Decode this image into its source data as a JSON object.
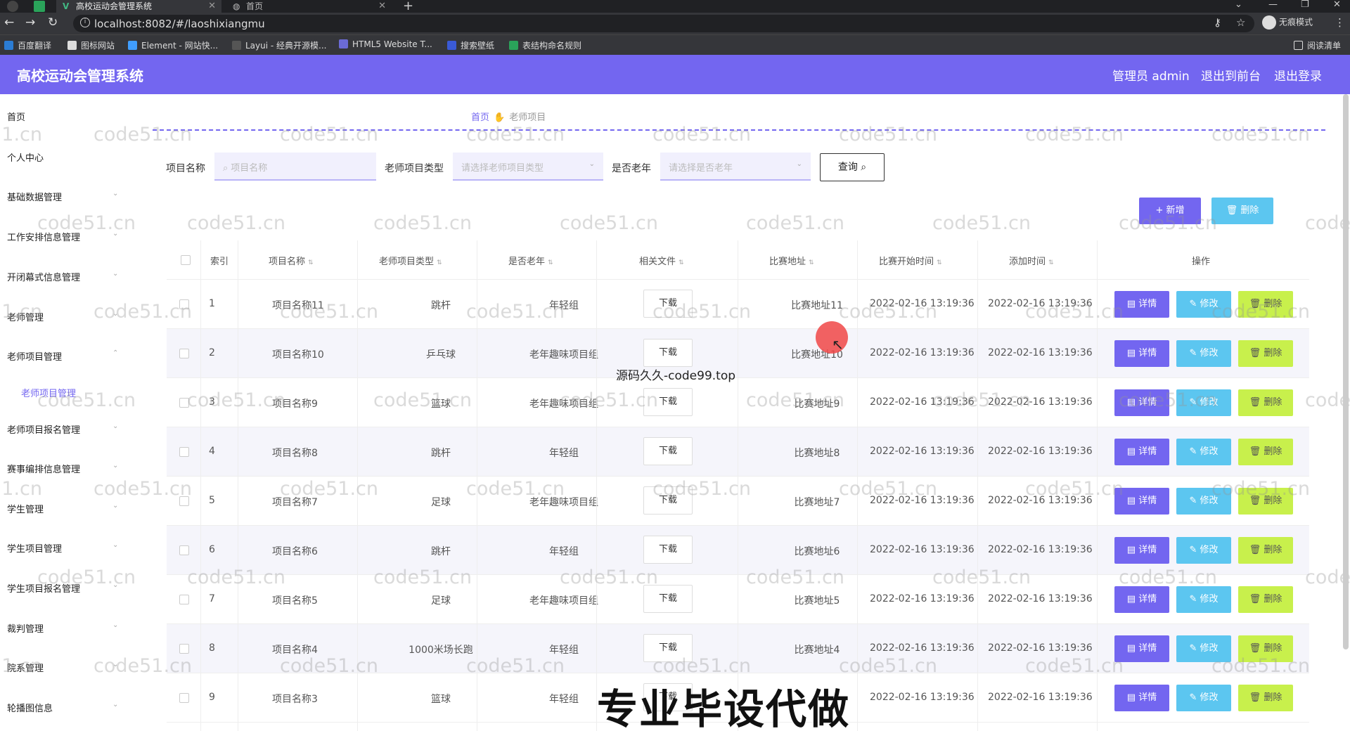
{
  "browser": {
    "tabs": [
      {
        "label": "高校运动会管理系统",
        "active": true
      },
      {
        "label": "首页",
        "active": false
      }
    ],
    "url": "localhost:8082/#/laoshixiangmu",
    "incognito_label": "无痕模式",
    "bookmarks": [
      "百度翻译",
      "图标网站",
      "Element - 网站快...",
      "Layui - 经典开源模...",
      "HTML5 Website T...",
      "搜索壁纸",
      "表结构命名规则"
    ],
    "reading_list": "阅读清单"
  },
  "header": {
    "title": "高校运动会管理系统",
    "user": "管理员 admin",
    "exit_front": "退出到前台",
    "logout": "退出登录",
    "color": "#7366f0"
  },
  "sidebar": {
    "items": [
      {
        "label": "首页"
      },
      {
        "label": "个人中心"
      },
      {
        "label": "基础数据管理"
      },
      {
        "label": "工作安排信息管理"
      },
      {
        "label": "开闭幕式信息管理"
      },
      {
        "label": "老师管理"
      },
      {
        "label": "老师项目管理"
      },
      {
        "label": "老师项目报名管理"
      },
      {
        "label": "赛事编排信息管理"
      },
      {
        "label": "学生管理"
      },
      {
        "label": "学生项目管理"
      },
      {
        "label": "学生项目报名管理"
      },
      {
        "label": "裁判管理"
      },
      {
        "label": "院系管理"
      },
      {
        "label": "轮播图信息"
      }
    ],
    "active_sub": "老师项目管理"
  },
  "breadcrumb": {
    "home": "首页",
    "current": "老师项目"
  },
  "filters": {
    "name_label": "项目名称",
    "name_placeholder": "项目名称",
    "type_label": "老师项目类型",
    "type_placeholder": "请选择老师项目类型",
    "old_label": "是否老年",
    "old_placeholder": "请选择是否老年",
    "query_button": "查询"
  },
  "actions": {
    "add": "+ 新增",
    "delete": "删除"
  },
  "table": {
    "columns": [
      "索引",
      "项目名称",
      "老师项目类型",
      "是否老年",
      "相关文件",
      "比赛地址",
      "比赛开始时间",
      "添加时间",
      "操作"
    ],
    "download_label": "下载",
    "row_buttons": {
      "detail": "详情",
      "edit": "修改",
      "delete": "删除"
    },
    "rows": [
      {
        "index": "1",
        "name": "项目名称11",
        "type": "跳杆",
        "old": "年轻组",
        "address": "比赛地址11",
        "start": "2022-02-16 13:19:36",
        "added": "2022-02-16 13:19:36"
      },
      {
        "index": "2",
        "name": "项目名称10",
        "type": "乒乓球",
        "old": "老年趣味项目组",
        "address": "比赛地址10",
        "start": "2022-02-16 13:19:36",
        "added": "2022-02-16 13:19:36"
      },
      {
        "index": "3",
        "name": "项目名称9",
        "type": "篮球",
        "old": "老年趣味项目组",
        "address": "比赛地址9",
        "start": "2022-02-16 13:19:36",
        "added": "2022-02-16 13:19:36"
      },
      {
        "index": "4",
        "name": "项目名称8",
        "type": "跳杆",
        "old": "年轻组",
        "address": "比赛地址8",
        "start": "2022-02-16 13:19:36",
        "added": "2022-02-16 13:19:36"
      },
      {
        "index": "5",
        "name": "项目名称7",
        "type": "足球",
        "old": "老年趣味项目组",
        "address": "比赛地址7",
        "start": "2022-02-16 13:19:36",
        "added": "2022-02-16 13:19:36"
      },
      {
        "index": "6",
        "name": "项目名称6",
        "type": "跳杆",
        "old": "年轻组",
        "address": "比赛地址6",
        "start": "2022-02-16 13:19:36",
        "added": "2022-02-16 13:19:36"
      },
      {
        "index": "7",
        "name": "项目名称5",
        "type": "足球",
        "old": "老年趣味项目组",
        "address": "比赛地址5",
        "start": "2022-02-16 13:19:36",
        "added": "2022-02-16 13:19:36"
      },
      {
        "index": "8",
        "name": "项目名称4",
        "type": "1000米场长跑",
        "old": "年轻组",
        "address": "比赛地址4",
        "start": "2022-02-16 13:19:36",
        "added": "2022-02-16 13:19:36"
      },
      {
        "index": "9",
        "name": "项目名称3",
        "type": "篮球",
        "old": "年轻组",
        "address": "",
        "start": "2022-02-16 13:19:36",
        "added": "2022-02-16 13:19:36"
      }
    ]
  },
  "overlays": {
    "watermark": "code51.cn",
    "mid_text": "源码久久-code99.top",
    "big_text": "专业毕设代做"
  }
}
